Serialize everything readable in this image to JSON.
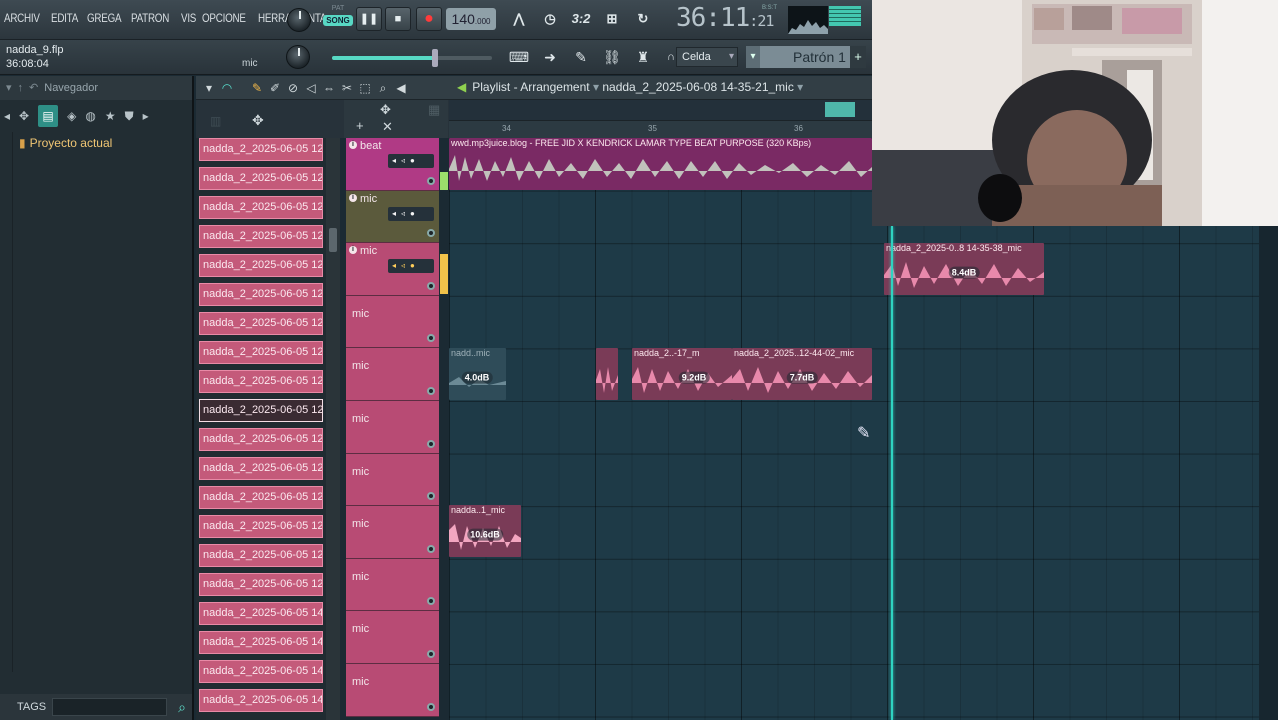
{
  "menu": [
    "ARCHIV",
    "EDITA",
    "GREGA",
    "PATRON",
    "VIS",
    "OPCIONE",
    "HERRAMIENTA"
  ],
  "transport": {
    "pat_label": "PAT",
    "song_label": "SONG",
    "tempo": "140",
    "tempo_decimals": ".000",
    "time_main": "36:11",
    "time_sub": "21",
    "time_unit": "B:S:T"
  },
  "file": {
    "name": "nadda_9.flp",
    "time": "36:08:04",
    "hint": "mic"
  },
  "snap": {
    "value": "Celda"
  },
  "pattern": {
    "name": "Patrón 1"
  },
  "browser": {
    "title": "Navegador",
    "tree_item": "Proyecto actual",
    "tags_label": "TAGS"
  },
  "playlist": {
    "title": "Playlist - Arrangement",
    "arrangement": "nadda_2_2025-06-08 14-35-21_mic",
    "ruler": [
      "34",
      "35",
      "36"
    ]
  },
  "clip_list": [
    "nadda_2_2025-06-05 12...",
    "nadda_2_2025-06-05 12...",
    "nadda_2_2025-06-05 12...",
    "nadda_2_2025-06-05 12...",
    "nadda_2_2025-06-05 12...",
    "nadda_2_2025-06-05 12...",
    "nadda_2_2025-06-05 12...",
    "nadda_2_2025-06-05 12...",
    "nadda_2_2025-06-05 12...",
    "nadda_2_2025-06-05 12...",
    "nadda_2_2025-06-05 12...",
    "nadda_2_2025-06-05 12...",
    "nadda_2_2025-06-05 12...",
    "nadda_2_2025-06-05 12...",
    "nadda_2_2025-06-05 12...",
    "nadda_2_2025-06-05 12...",
    "nadda_2_2025-06-05 14...",
    "nadda_2_2025-06-05 14...",
    "nadda_2_2025-06-05 14...",
    "nadda_2_2025-06-05 14..."
  ],
  "tracks": [
    {
      "name": "beat"
    },
    {
      "name": "mic"
    },
    {
      "name": "mic"
    },
    {
      "name": "mic"
    },
    {
      "name": "mic"
    },
    {
      "name": "mic"
    },
    {
      "name": "mic"
    },
    {
      "name": "mic"
    },
    {
      "name": "mic"
    },
    {
      "name": "mic"
    },
    {
      "name": "mic"
    }
  ],
  "clips": {
    "beat": "wwd.mp3juice.blog - FREE JID X KENDRICK LAMAR TYPE BEAT PURPOSE (320 KBps)",
    "c1_label": "nadda_2_2025-0..8 14-35-38_mic",
    "c1_db": "8.4dB",
    "c2_label": "nadd..mic",
    "c2_db": "4.0dB",
    "c3_label": "nadda_2..-17_m",
    "c3_db": "9.2dB",
    "c4_label": "nadda_2_2025..12-44-02_mic",
    "c4_db": "7.7dB",
    "c5_label": "nadda..1_mic",
    "c5_db": "10.6dB"
  }
}
